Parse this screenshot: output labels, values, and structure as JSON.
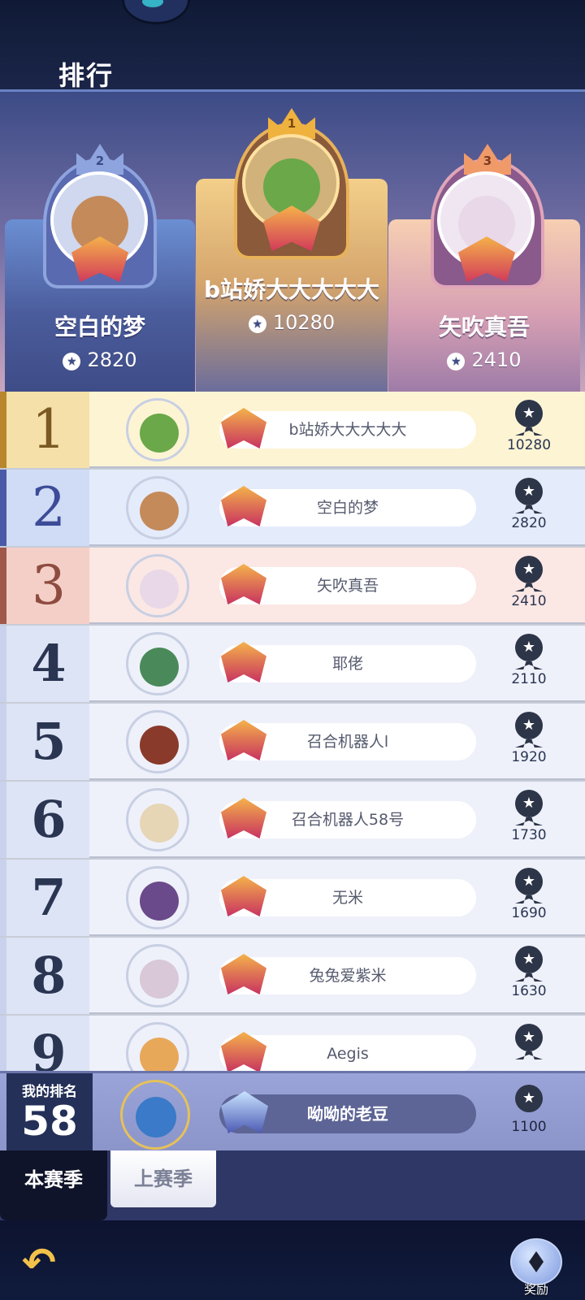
{
  "header": {
    "title": "排行"
  },
  "podium": [
    {
      "rank": "2",
      "name": "空白的梦",
      "score": "2820"
    },
    {
      "rank": "1",
      "name": "b站娇大大大大大",
      "score": "10280"
    },
    {
      "rank": "3",
      "name": "矢吹真吾",
      "score": "2410"
    }
  ],
  "colors": {
    "gold": "#f0b23e",
    "silver": "#8ea4de",
    "bronze": "#f09a6a",
    "accent": "#3c4b86"
  },
  "rows": [
    {
      "rank": "1",
      "name": "b站娇大大大大大",
      "score": "10280"
    },
    {
      "rank": "2",
      "name": "空白的梦",
      "score": "2820"
    },
    {
      "rank": "3",
      "name": "矢吹真吾",
      "score": "2410"
    },
    {
      "rank": "4",
      "name": "耶佬",
      "score": "2110"
    },
    {
      "rank": "5",
      "name": "召合机器人l",
      "score": "1920"
    },
    {
      "rank": "6",
      "name": "召合机器人58号",
      "score": "1730"
    },
    {
      "rank": "7",
      "name": "无米",
      "score": "1690"
    },
    {
      "rank": "8",
      "name": "兔兔爱紫米",
      "score": "1630"
    },
    {
      "rank": "9",
      "name": "Aegis",
      "score": ""
    }
  ],
  "my_rank": {
    "label": "我的排名",
    "rank": "58",
    "name": "呦呦的老豆",
    "score": "1100"
  },
  "tabs": [
    {
      "label": "本赛季",
      "active": true
    },
    {
      "label": "上赛季",
      "active": false
    }
  ],
  "footer": {
    "reward_label": "奖励",
    "back_icon": "back-arrow-icon",
    "reward_icon": "reward-chest-icon"
  }
}
